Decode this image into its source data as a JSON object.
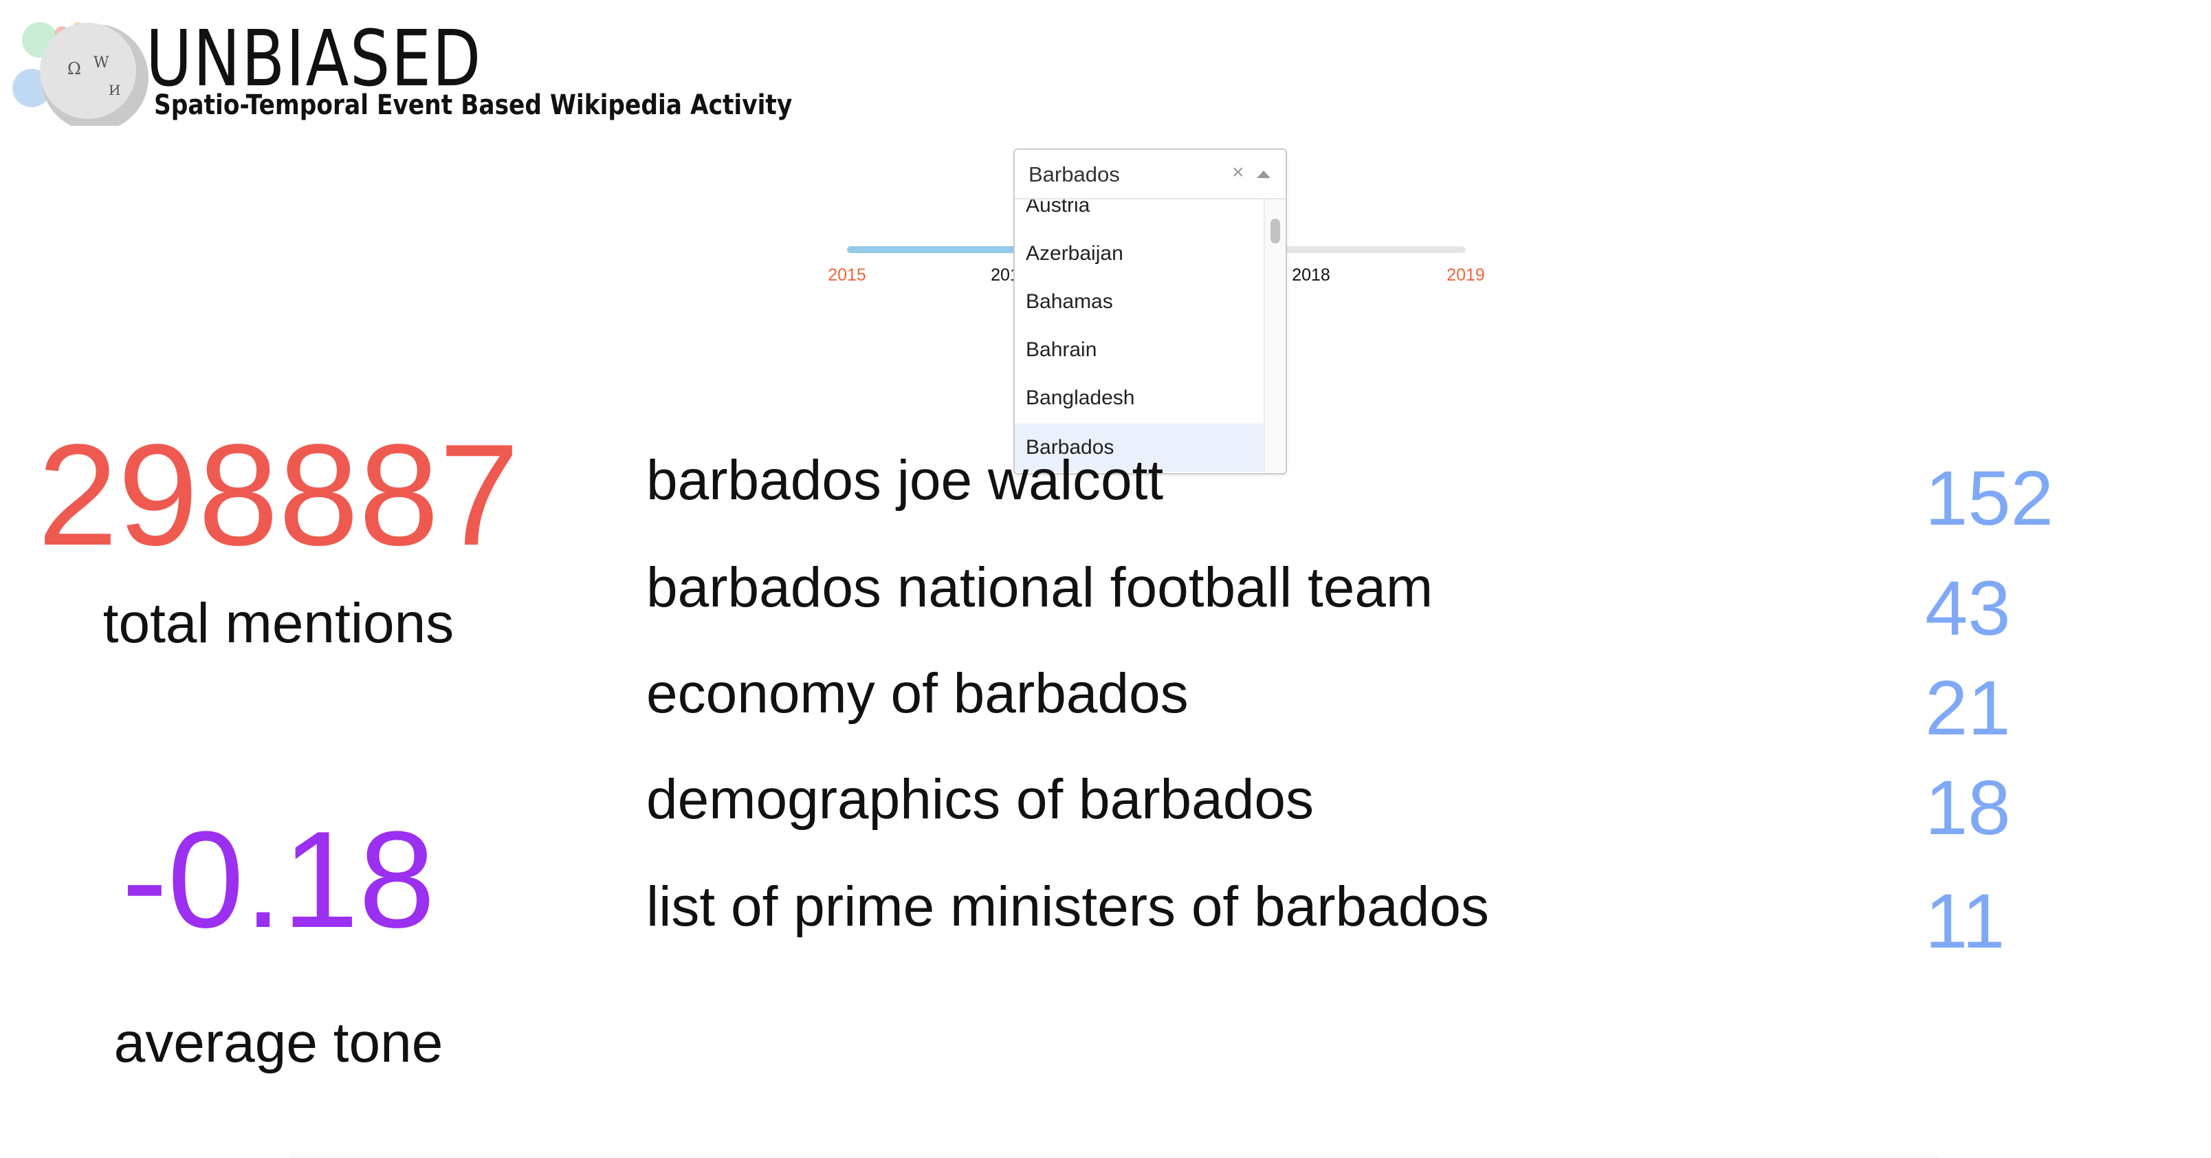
{
  "header": {
    "title": "UNBIASED",
    "subtitle": "Spatio-Temporal Event Based Wikipedia Activity",
    "logo_icon": "wikipedia-globe-network-logo"
  },
  "timeline": {
    "ticks": [
      "2015",
      "201",
      "2018",
      "2019"
    ],
    "track_color": "#e6e6e6",
    "fill_color": "#93cbe8",
    "end_label_color": "#f0653b"
  },
  "country_select": {
    "value": "Barbados",
    "clear_icon": "close-icon",
    "arrow_icon": "caret-up-icon",
    "options": [
      "Austria",
      "Azerbaijan",
      "Bahamas",
      "Bahrain",
      "Bangladesh",
      "Barbados"
    ]
  },
  "stats": {
    "total_mentions": "298887",
    "total_mentions_label": "total mentions",
    "total_color": "#ef5a50",
    "average_tone": "-0.18",
    "average_tone_label": "average tone",
    "tone_color": "#9b30f0"
  },
  "topics": [
    {
      "title": "barbados joe walcott",
      "count": "152"
    },
    {
      "title": "barbados national football team",
      "count": "43"
    },
    {
      "title": "economy of barbados",
      "count": "21"
    },
    {
      "title": "demographics of barbados",
      "count": "18"
    },
    {
      "title": "list of prime ministers of barbados",
      "count": "11"
    }
  ],
  "count_color": "#7fa9f7"
}
